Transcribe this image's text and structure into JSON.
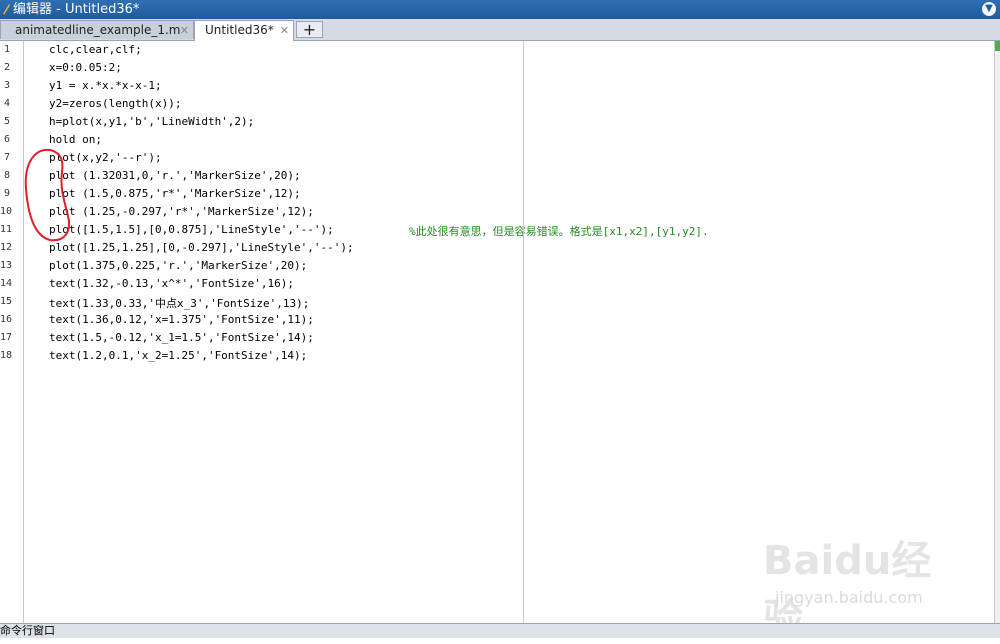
{
  "window": {
    "title": "编辑器 - Untitled36*"
  },
  "tabs": [
    {
      "label": "animatedline_example_1.m"
    },
    {
      "label": "Untitled36*"
    }
  ],
  "new_tab_label": "+",
  "gutter": [
    "1",
    "2",
    "3",
    "4",
    "5",
    "6",
    "7",
    "8",
    "9",
    "10",
    "11",
    "12",
    "13",
    "14",
    "15",
    "16",
    "17",
    "18"
  ],
  "lines": [
    "clc,clear,clf;",
    "x=0:0.05:2;",
    "y1 = x.*x.*x-x-1;",
    "y2=zeros(length(x));",
    "h=plot(x,y1,'b','LineWidth',2);",
    "hold on;",
    "plot(x,y2,'--r');",
    "plot (1.32031,0,'r.','MarkerSize',20);",
    "plot (1.5,0.875,'r*','MarkerSize',12);",
    "plot (1.25,-0.297,'r*','MarkerSize',12);",
    "plot([1.5,1.5],[0,0.875],'LineStyle','--');",
    "plot([1.25,1.25],[0,-0.297],'LineStyle','--');",
    "plot(1.375,0.225,'r.','MarkerSize',20);",
    "text(1.32,-0.13,'x^*','FontSize',16);",
    "text(1.33,0.33,'中点x_3','FontSize',13);",
    "text(1.36,0.12,'x=1.375','FontSize',11);",
    "text(1.5,-0.12,'x_1=1.5','FontSize',14);",
    "text(1.2,0.1,'x_2=1.25','FontSize',14);"
  ],
  "comment_line11": "%此处很有意思，但是容易错误。格式是[x1,x2],[y1,y2].",
  "bottom_panel": {
    "label": "命令行窗口"
  },
  "watermark": {
    "logo": "Baidu经验",
    "url": "jingyan.baidu.com"
  },
  "colors": {
    "titlebar": "#2f6fb3",
    "string": "#a020f0",
    "comment": "#228b22",
    "annotation": "#e0202a"
  },
  "icons": [
    "editor-app-icon",
    "window-menu-icon",
    "close-icon"
  ]
}
